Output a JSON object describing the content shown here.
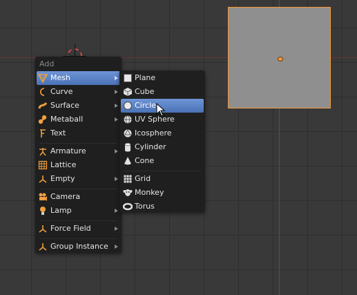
{
  "add_menu": {
    "title": "Add",
    "items": [
      {
        "label": "Mesh",
        "icon": "mesh-icon",
        "submenu": true
      },
      {
        "label": "Curve",
        "icon": "curve-icon",
        "submenu": true
      },
      {
        "label": "Surface",
        "icon": "surface-icon",
        "submenu": true
      },
      {
        "label": "Metaball",
        "icon": "metaball-icon",
        "submenu": true
      },
      {
        "label": "Text",
        "icon": "text-icon",
        "submenu": false
      },
      {
        "label": "Armature",
        "icon": "armature-icon",
        "submenu": true
      },
      {
        "label": "Lattice",
        "icon": "lattice-icon",
        "submenu": false
      },
      {
        "label": "Empty",
        "icon": "empty-icon",
        "submenu": true
      },
      {
        "label": "Camera",
        "icon": "camera-icon",
        "submenu": false
      },
      {
        "label": "Lamp",
        "icon": "lamp-icon",
        "submenu": true
      },
      {
        "label": "Force Field",
        "icon": "force-field-icon",
        "submenu": true
      },
      {
        "label": "Group Instance",
        "icon": "group-instance-icon",
        "submenu": true
      }
    ],
    "highlighted": "Mesh"
  },
  "mesh_submenu": {
    "items": [
      {
        "label": "Plane",
        "icon": "plane-icon"
      },
      {
        "label": "Cube",
        "icon": "cube-icon"
      },
      {
        "label": "Circle",
        "icon": "circle-icon"
      },
      {
        "label": "UV Sphere",
        "icon": "uv-sphere-icon"
      },
      {
        "label": "Icosphere",
        "icon": "icosphere-icon"
      },
      {
        "label": "Cylinder",
        "icon": "cylinder-icon"
      },
      {
        "label": "Cone",
        "icon": "cone-icon"
      },
      {
        "label": "Grid",
        "icon": "grid-icon"
      },
      {
        "label": "Monkey",
        "icon": "monkey-icon"
      },
      {
        "label": "Torus",
        "icon": "torus-icon"
      }
    ],
    "highlighted": "Circle"
  },
  "colors": {
    "highlight": "#5680c2",
    "menu_bg": "#1f1f1f",
    "selection_outline": "#f39a3b",
    "x_axis": "#6b3434",
    "y_axis": "#2f6a2f"
  }
}
